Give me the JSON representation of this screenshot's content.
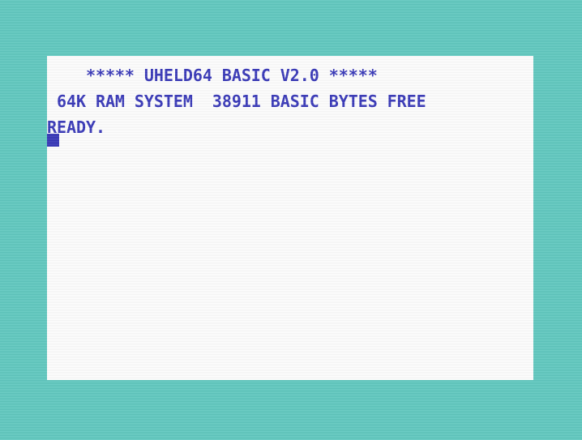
{
  "screen": {
    "banner_line": "    ***** UHELD64 BASIC V2.0 *****",
    "memory_line": " 64K RAM SYSTEM  38911 BASIC BYTES FREE",
    "prompt_line": "READY."
  },
  "colors": {
    "border": "#5fc9c0",
    "background": "#ffffff",
    "text": "#3535b8"
  }
}
